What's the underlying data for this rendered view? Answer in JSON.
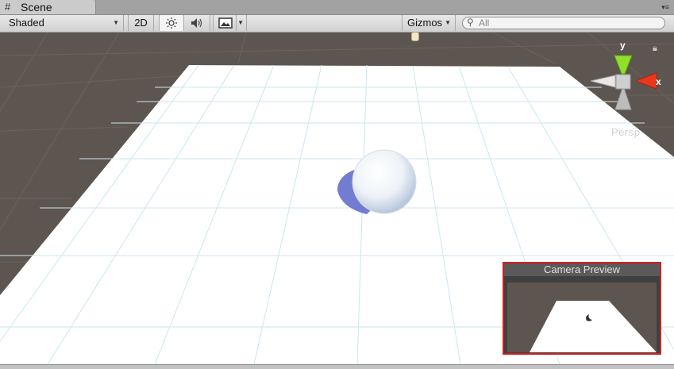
{
  "tab": {
    "label": "Scene",
    "icon": "grid-icon"
  },
  "toolbar": {
    "draw_mode": "Shaded",
    "mode_2d": "2D",
    "gizmos_label": "Gizmos",
    "search_placeholder": "All"
  },
  "gizmo": {
    "y_label": "y",
    "x_label": "x",
    "projection_label": "Persp"
  },
  "camera_preview": {
    "title": "Camera Preview"
  },
  "colors": {
    "background": "#5d554f",
    "plane": "#ffffff",
    "camera_preview_border": "#d11f1f",
    "gizmo_y": "#8ee02a",
    "gizmo_x": "#e8381c"
  }
}
